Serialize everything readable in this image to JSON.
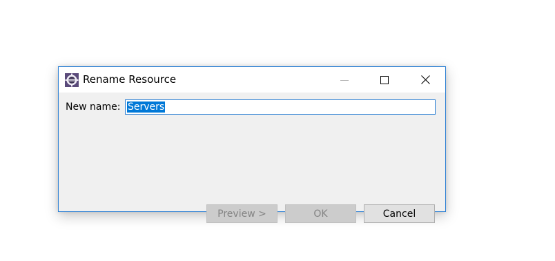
{
  "window": {
    "title": "Rename Resource",
    "icon": "eclipse-gear-icon"
  },
  "form": {
    "label": "New name:",
    "value": "Servers"
  },
  "buttons": {
    "preview": "Preview >",
    "ok": "OK",
    "cancel": "Cancel"
  },
  "colors": {
    "accent": "#0078d7",
    "border": "#2a7fd4"
  }
}
